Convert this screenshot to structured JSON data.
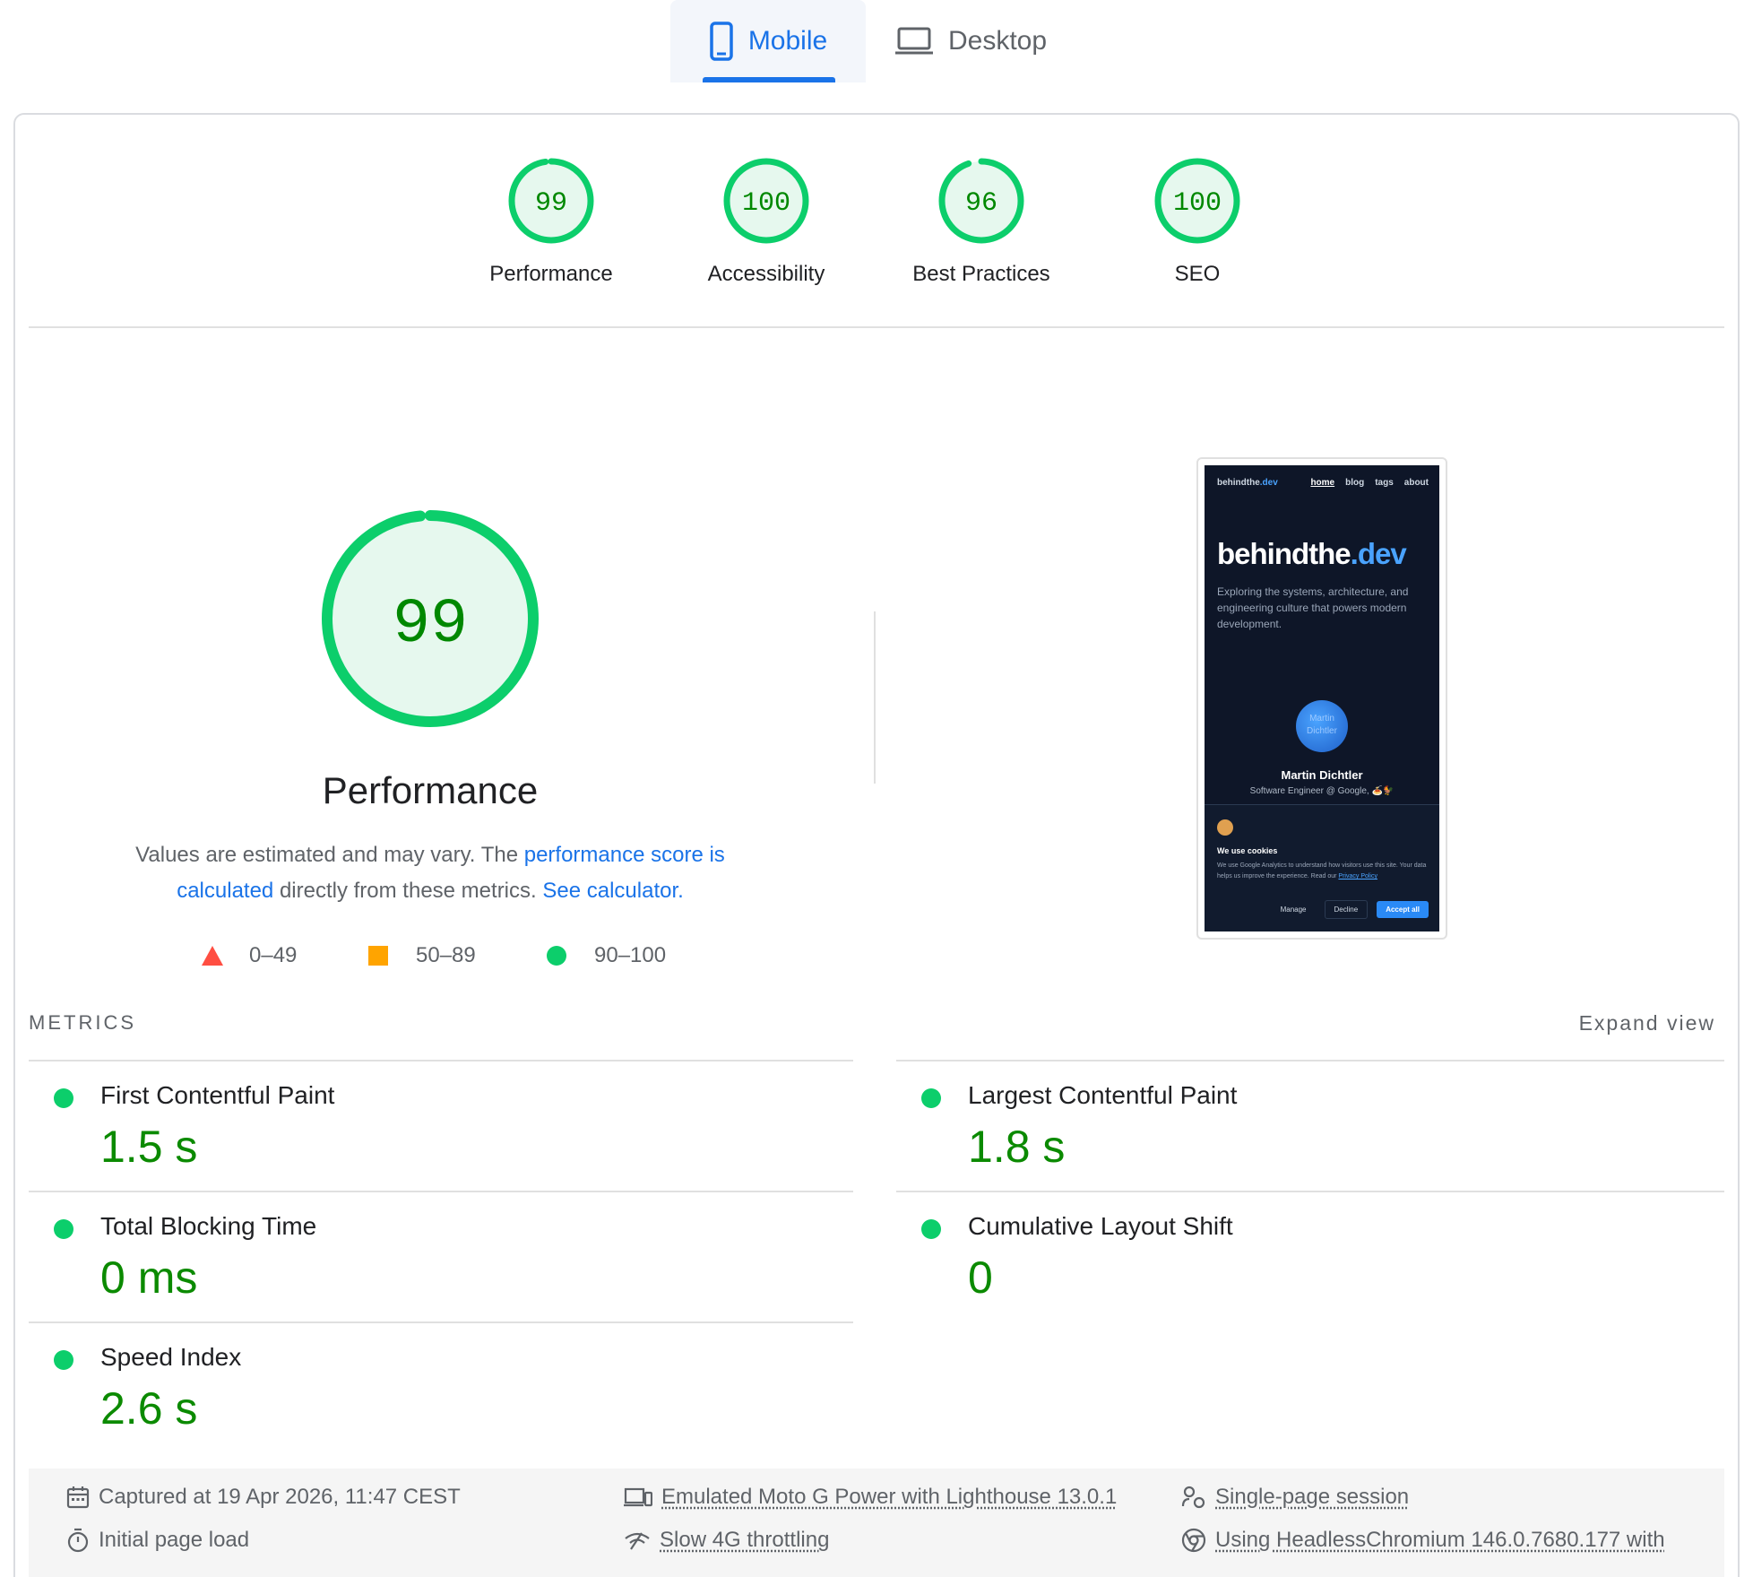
{
  "tabs": {
    "mobile": "Mobile",
    "desktop": "Desktop",
    "active": "Mobile"
  },
  "categories": [
    {
      "label": "Performance",
      "score": "99",
      "value": 99
    },
    {
      "label": "Accessibility",
      "score": "100",
      "value": 100
    },
    {
      "label": "Best Practices",
      "score": "96",
      "value": 96
    },
    {
      "label": "SEO",
      "score": "100",
      "value": 100
    }
  ],
  "performance": {
    "score": "99",
    "value": 99,
    "title": "Performance",
    "desc_prefix": "Values are estimated and may vary. The ",
    "desc_link1": "performance score is calculated",
    "desc_middle": " directly from these metrics. ",
    "desc_link2": "See calculator.",
    "legend": {
      "fail": "0–49",
      "average": "50–89",
      "pass": "90–100"
    }
  },
  "screenshot": {
    "brand": "behindthe.dev",
    "brand_a": "behindthe",
    "brand_b": ".dev",
    "nav": [
      "home",
      "blog",
      "tags",
      "about"
    ],
    "subtitle": "Exploring the systems, architecture, and engineering culture that powers modern development.",
    "avatar_text": "Martin Dichtler",
    "name": "Martin Dichtler",
    "role": "Software Engineer @ Google, 🍝🐓",
    "cookie_title": "We use cookies",
    "cookie_text": "We use Google Analytics to understand how visitors use this site. Your data helps us improve the experience. Read our ",
    "cookie_link": "Privacy Policy",
    "buttons": {
      "manage": "Manage",
      "decline": "Decline",
      "accept": "Accept all"
    }
  },
  "metrics": {
    "title": "METRICS",
    "expand": "Expand view",
    "items": [
      {
        "name": "First Contentful Paint",
        "value": "1.5 s"
      },
      {
        "name": "Largest Contentful Paint",
        "value": "1.8 s"
      },
      {
        "name": "Total Blocking Time",
        "value": "0 ms"
      },
      {
        "name": "Cumulative Layout Shift",
        "value": "0"
      },
      {
        "name": "Speed Index",
        "value": "2.6 s"
      }
    ]
  },
  "footer": {
    "captured": "Captured at 19 Apr 2026, 11:47 CEST",
    "initial_load": "Initial page load",
    "emulated": "Emulated Moto G Power with Lighthouse 13.0.1",
    "throttling": "Slow 4G throttling",
    "session": "Single-page session",
    "browser": "Using HeadlessChromium 146.0.7680.177 with"
  },
  "colors": {
    "pass": "#0cce6b",
    "pass_text": "#008800",
    "pass_fill": "#e6f8ee",
    "average": "#ffa400",
    "fail": "#ff4e42",
    "link": "#1a73e8"
  }
}
